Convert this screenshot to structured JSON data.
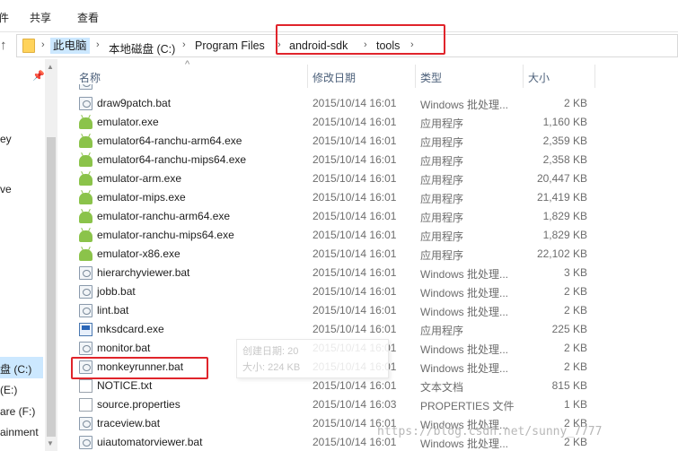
{
  "ribbon": {
    "tabs": [
      "件",
      "共享",
      "查看"
    ]
  },
  "address": {
    "crumbs": [
      "此电脑",
      "本地磁盘 (C:)",
      "Program Files",
      "android-sdk",
      "tools"
    ]
  },
  "nav": {
    "items": [
      "ey",
      "ve",
      "盘 (C:)",
      "(E:)",
      "are (F:)",
      "ainment"
    ]
  },
  "headers": {
    "name": "名称",
    "date": "修改日期",
    "type": "类型",
    "size": "大小"
  },
  "files": [
    {
      "name": "draw9patch.bat",
      "date": "2015/10/14 16:01",
      "type": "Windows 批处理...",
      "size": "2 KB",
      "icon": "bat-file-icon"
    },
    {
      "name": "emulator.exe",
      "date": "2015/10/14 16:01",
      "type": "应用程序",
      "size": "1,160 KB",
      "icon": "android-exe-icon"
    },
    {
      "name": "emulator64-ranchu-arm64.exe",
      "date": "2015/10/14 16:01",
      "type": "应用程序",
      "size": "2,359 KB",
      "icon": "android-exe-icon"
    },
    {
      "name": "emulator64-ranchu-mips64.exe",
      "date": "2015/10/14 16:01",
      "type": "应用程序",
      "size": "2,358 KB",
      "icon": "android-exe-icon"
    },
    {
      "name": "emulator-arm.exe",
      "date": "2015/10/14 16:01",
      "type": "应用程序",
      "size": "20,447 KB",
      "icon": "android-exe-icon"
    },
    {
      "name": "emulator-mips.exe",
      "date": "2015/10/14 16:01",
      "type": "应用程序",
      "size": "21,419 KB",
      "icon": "android-exe-icon"
    },
    {
      "name": "emulator-ranchu-arm64.exe",
      "date": "2015/10/14 16:01",
      "type": "应用程序",
      "size": "1,829 KB",
      "icon": "android-exe-icon"
    },
    {
      "name": "emulator-ranchu-mips64.exe",
      "date": "2015/10/14 16:01",
      "type": "应用程序",
      "size": "1,829 KB",
      "icon": "android-exe-icon"
    },
    {
      "name": "emulator-x86.exe",
      "date": "2015/10/14 16:01",
      "type": "应用程序",
      "size": "22,102 KB",
      "icon": "android-exe-icon"
    },
    {
      "name": "hierarchyviewer.bat",
      "date": "2015/10/14 16:01",
      "type": "Windows 批处理...",
      "size": "3 KB",
      "icon": "bat-file-icon"
    },
    {
      "name": "jobb.bat",
      "date": "2015/10/14 16:01",
      "type": "Windows 批处理...",
      "size": "2 KB",
      "icon": "bat-file-icon"
    },
    {
      "name": "lint.bat",
      "date": "2015/10/14 16:01",
      "type": "Windows 批处理...",
      "size": "2 KB",
      "icon": "bat-file-icon"
    },
    {
      "name": "mksdcard.exe",
      "date": "2015/10/14 16:01",
      "type": "应用程序",
      "size": "225 KB",
      "icon": "app-exe-icon"
    },
    {
      "name": "monitor.bat",
      "date": "2015/10/14 16:01",
      "type": "Windows 批处理...",
      "size": "2 KB",
      "icon": "bat-file-icon"
    },
    {
      "name": "monkeyrunner.bat",
      "date": "2015/10/14 16:01",
      "type": "Windows 批处理...",
      "size": "2 KB",
      "icon": "bat-file-icon"
    },
    {
      "name": "NOTICE.txt",
      "date": "2015/10/14 16:01",
      "type": "文本文档",
      "size": "815 KB",
      "icon": "text-file-icon"
    },
    {
      "name": "source.properties",
      "date": "2015/10/14 16:03",
      "type": "PROPERTIES 文件",
      "size": "1 KB",
      "icon": "properties-file-icon"
    },
    {
      "name": "traceview.bat",
      "date": "2015/10/14 16:01",
      "type": "Windows 批处理...",
      "size": "2 KB",
      "icon": "bat-file-icon"
    },
    {
      "name": "uiautomatorviewer.bat",
      "date": "2015/10/14 16:01",
      "type": "Windows 批处理...",
      "size": "2 KB",
      "icon": "bat-file-icon"
    }
  ],
  "tooltip": {
    "line1": "创建日期: 20",
    "line2": "大小: 224 KB"
  },
  "watermark": "https://blog.csdn.net/sunny_7777",
  "colors": {
    "highlight_box": "#e0242b",
    "selection": "#cce8ff"
  }
}
